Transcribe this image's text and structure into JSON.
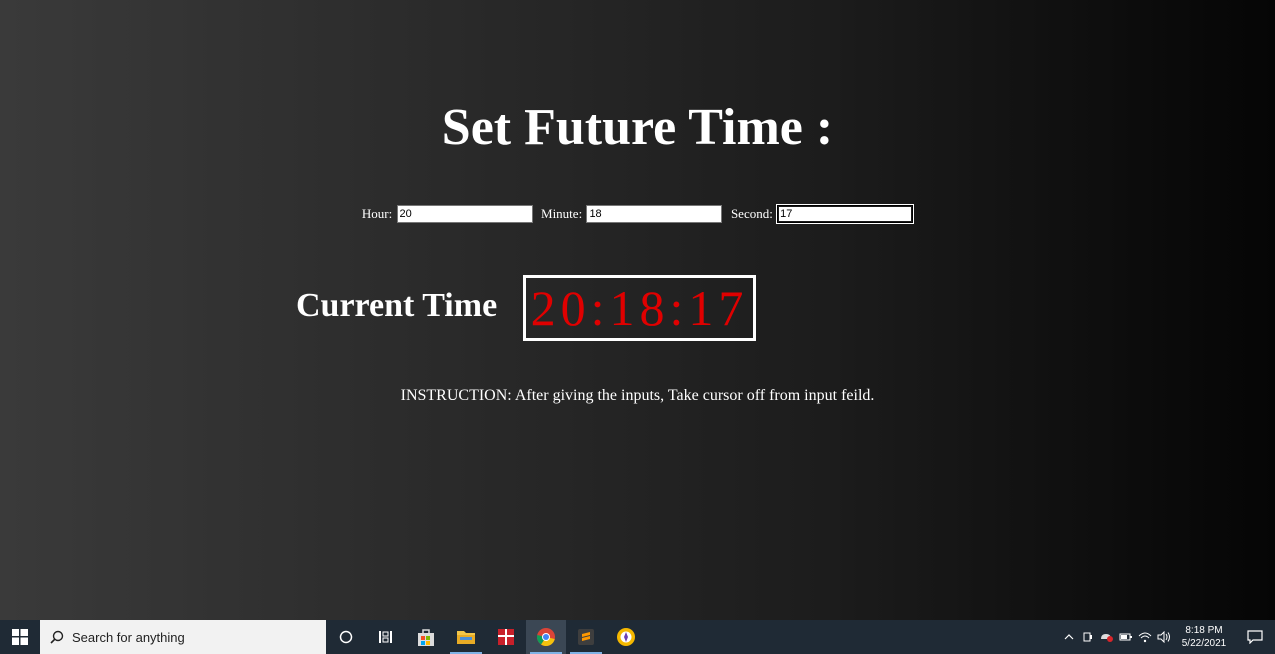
{
  "title": "Set Future Time :",
  "inputs": {
    "hour_label": "Hour:",
    "hour_value": "20",
    "minute_label": "Minute:",
    "minute_value": "18",
    "second_label": "Second:",
    "second_value": "17"
  },
  "clock": {
    "label": "Current Time",
    "display": "20:18:17",
    "color": "#e00000"
  },
  "instruction": "INSTRUCTION: After giving the inputs, Take cursor off from input feild.",
  "taskbar": {
    "search_placeholder": "Search for anything",
    "apps": [
      "cortana-icon",
      "task-view-icon",
      "store-icon",
      "file-explorer-icon",
      "gift-icon",
      "chrome-icon",
      "sublime-text-icon",
      "browser-icon"
    ],
    "time": "8:18 PM",
    "date": "5/22/2021"
  }
}
